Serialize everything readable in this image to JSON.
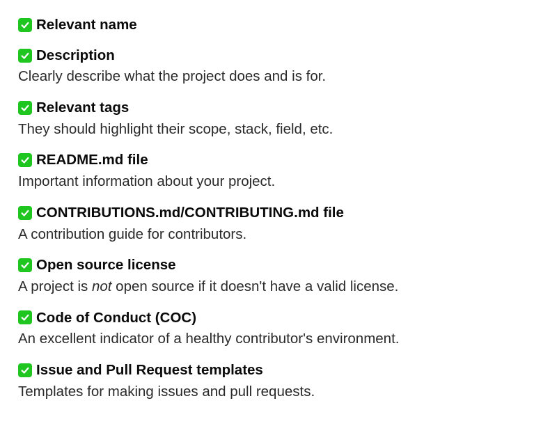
{
  "items": [
    {
      "title": "Relevant name",
      "desc_before": "",
      "desc_em": "",
      "desc_after": ""
    },
    {
      "title": "Description",
      "desc_before": "Clearly describe what the project does and is for.",
      "desc_em": "",
      "desc_after": ""
    },
    {
      "title": "Relevant tags",
      "desc_before": "They should highlight their scope, stack, field, etc.",
      "desc_em": "",
      "desc_after": ""
    },
    {
      "title": "README.md file",
      "desc_before": "Important information about your project.",
      "desc_em": "",
      "desc_after": ""
    },
    {
      "title": "CONTRIBUTIONS.md/CONTRIBUTING.md file",
      "desc_before": "A contribution guide for contributors.",
      "desc_em": "",
      "desc_after": ""
    },
    {
      "title": "Open source license",
      "desc_before": "A project is ",
      "desc_em": "not",
      "desc_after": " open source if it doesn't have a valid license."
    },
    {
      "title": "Code of Conduct (COC)",
      "desc_before": "An excellent indicator of a healthy contributor's environment.",
      "desc_em": "",
      "desc_after": ""
    },
    {
      "title": "Issue and Pull Request templates",
      "desc_before": "Templates for making issues and pull requests.",
      "desc_em": "",
      "desc_after": ""
    }
  ]
}
